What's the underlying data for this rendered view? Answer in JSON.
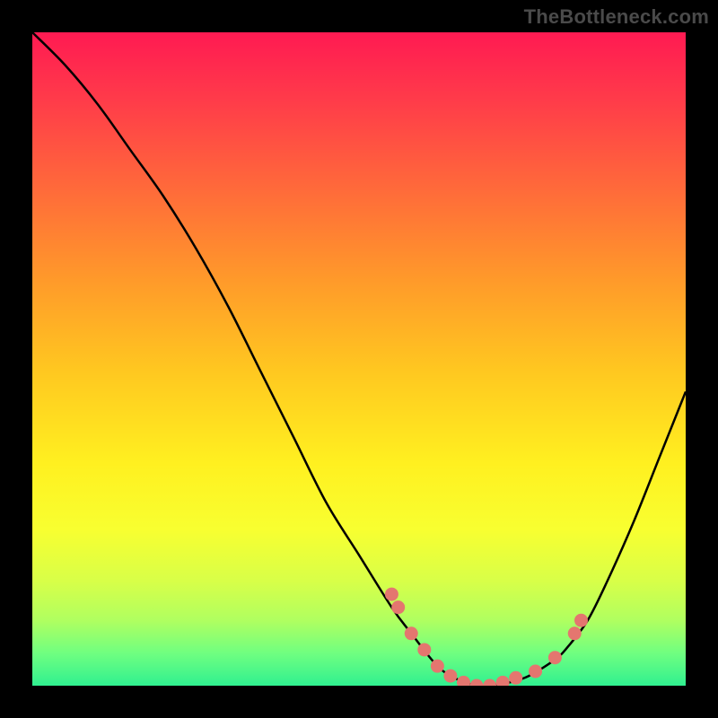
{
  "watermark": "TheBottleneck.com",
  "colors": {
    "frame": "#000000",
    "curve": "#000000",
    "dot": "#e4766f",
    "gradient_stops": [
      "#ff1a52",
      "#ff3a4a",
      "#ff6a3a",
      "#ff9a2a",
      "#ffc820",
      "#fff020",
      "#f8ff30",
      "#d8ff48",
      "#b0ff60",
      "#70ff80",
      "#30f090"
    ]
  },
  "chart_data": {
    "type": "line",
    "title": "",
    "xlabel": "",
    "ylabel": "",
    "xlim": [
      0,
      100
    ],
    "ylim": [
      0,
      100
    ],
    "series": [
      {
        "name": "curve",
        "x": [
          0,
          5,
          10,
          15,
          20,
          25,
          30,
          35,
          40,
          45,
          50,
          55,
          58,
          62,
          65,
          68,
          70,
          73,
          76,
          80,
          82,
          85,
          88,
          92,
          96,
          100
        ],
        "values": [
          100,
          95,
          89,
          82,
          75,
          67,
          58,
          48,
          38,
          28,
          20,
          12,
          8,
          3,
          1,
          0,
          0,
          0.5,
          1.5,
          4,
          6,
          10,
          16,
          25,
          35,
          45
        ]
      }
    ],
    "points": {
      "name": "dots",
      "x": [
        55,
        56,
        58,
        60,
        62,
        64,
        66,
        68,
        70,
        72,
        74,
        77,
        80,
        83,
        84
      ],
      "values": [
        14,
        12,
        8,
        5.5,
        3,
        1.5,
        0.5,
        0,
        0,
        0.5,
        1.2,
        2.2,
        4.3,
        8,
        10
      ]
    }
  }
}
